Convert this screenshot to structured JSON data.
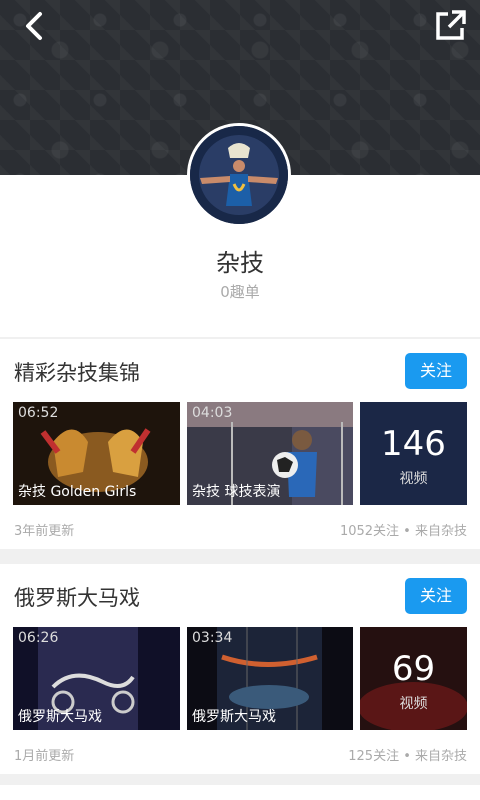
{
  "header": {
    "back_icon": "chevron-left-icon",
    "share_icon": "external-link-icon"
  },
  "profile": {
    "name": "杂技",
    "count": "0趣单"
  },
  "cards": [
    {
      "title": "精彩杂技集锦",
      "follow_label": "关注",
      "videos": [
        {
          "duration": "06:52",
          "caption": "杂技   Golden Girls"
        },
        {
          "duration": "04:03",
          "caption": "杂技 球技表演"
        }
      ],
      "more": {
        "count": "146",
        "label": "视频"
      },
      "updated": "3年前更新",
      "meta": "1052关注 • 来自杂技"
    },
    {
      "title": "俄罗斯大马戏",
      "follow_label": "关注",
      "videos": [
        {
          "duration": "06:26",
          "caption": "俄罗斯大马戏"
        },
        {
          "duration": "03:34",
          "caption": "俄罗斯大马戏"
        }
      ],
      "more": {
        "count": "69",
        "label": "视频"
      },
      "updated": "1月前更新",
      "meta": "125关注 • 来自杂技"
    }
  ],
  "colors": {
    "accent": "#1a9af0",
    "header_bg": "#2b2e33"
  }
}
